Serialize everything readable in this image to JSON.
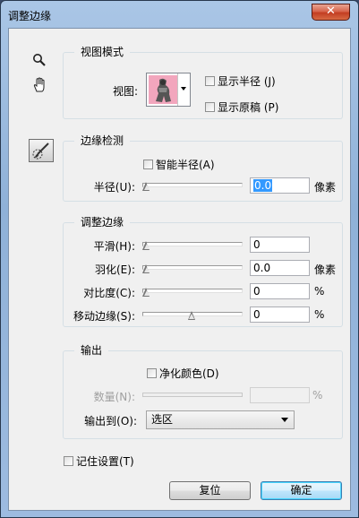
{
  "window": {
    "title": "调整边缘",
    "close_glyph": "✕"
  },
  "tools": [
    {
      "name": "zoom-tool",
      "icon": "zoom-icon",
      "glyph": "🔍"
    },
    {
      "name": "hand-tool",
      "icon": "hand-icon",
      "glyph": "✋"
    },
    {
      "name": "refine-radius-tool",
      "icon": "refine-radius-brush-icon",
      "glyph": "✎"
    }
  ],
  "view_mode": {
    "legend": "视图模式",
    "view_label": "视图:",
    "show_radius": {
      "label": "显示半径 (J)",
      "checked": false
    },
    "show_original": {
      "label": "显示原稿 (P)",
      "checked": false
    }
  },
  "edge_detection": {
    "legend": "边缘检测",
    "smart_radius": {
      "label": "智能半径(A)",
      "checked": false
    },
    "radius": {
      "label": "半径(U):",
      "value": "0.0",
      "unit": "像素",
      "level": 0
    }
  },
  "adjust_edge": {
    "legend": "调整边缘",
    "smooth": {
      "label": "平滑(H):",
      "value": "0",
      "unit": "",
      "level": 0
    },
    "feather": {
      "label": "羽化(E):",
      "value": "0.0",
      "unit": "像素",
      "level": 0
    },
    "contrast": {
      "label": "对比度(C):",
      "value": "0",
      "unit": "%",
      "level": 0
    },
    "shift_edge": {
      "label": "移动边缘(S):",
      "value": "0",
      "unit": "%",
      "level": 0.5
    }
  },
  "output": {
    "legend": "输出",
    "decontaminate": {
      "label": "净化颜色(D)",
      "checked": false
    },
    "amount": {
      "label": "数量(N):",
      "value": "",
      "unit": "%",
      "disabled": true
    },
    "output_to": {
      "label": "输出到(O):",
      "value": "选区"
    }
  },
  "remember": {
    "label": "记住设置(T)",
    "checked": false
  },
  "buttons": {
    "reset": "复位",
    "ok": "确定"
  }
}
